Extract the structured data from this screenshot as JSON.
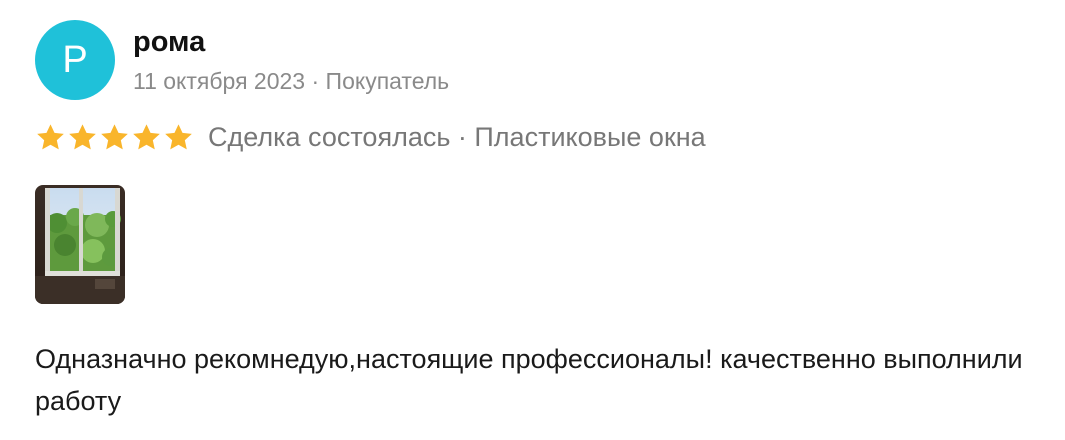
{
  "author": {
    "initial": "Р",
    "name": "рома"
  },
  "meta": {
    "date": "11 октября 2023",
    "separator": "·",
    "role": "Покупатель"
  },
  "rating": {
    "value": 5,
    "max": 5,
    "star_color": "#f9b52b",
    "text": "Сделка состоялась · Пластиковые окна"
  },
  "photo": {
    "icon": "photo-thumbnail"
  },
  "review": {
    "text": "Одназначно рекомнедую,настоящие профессионалы! качественно выполнили работу"
  }
}
